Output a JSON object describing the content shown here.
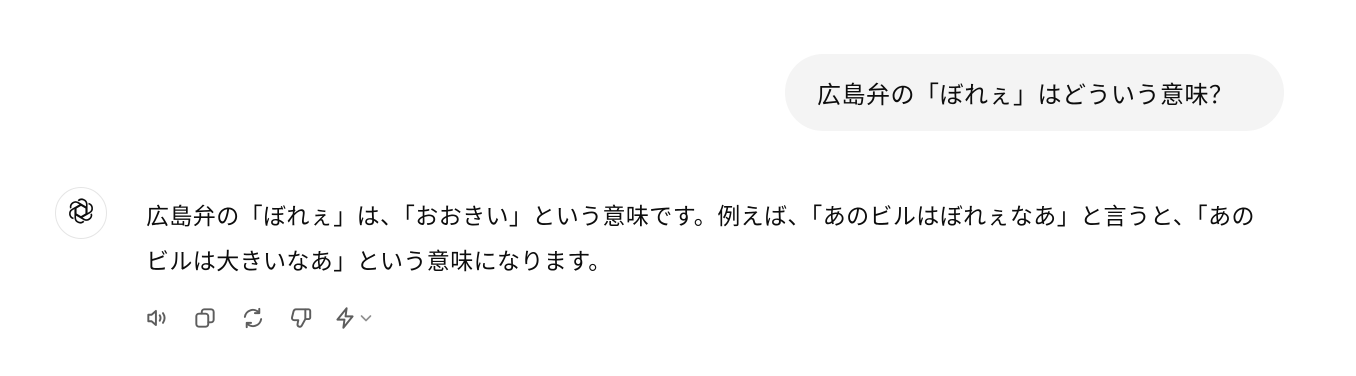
{
  "conversation": {
    "user_message": "広島弁の「ぼれぇ」はどういう意味？",
    "assistant_message": "広島弁の「ぼれぇ」は、「おおきい」という意味です。例えば、「あのビルはぼれぇなあ」と言うと、「あのビルは大きいなあ」という意味になります。"
  },
  "assistant": {
    "avatar_icon": "openai-logo-icon"
  },
  "actions": [
    {
      "name": "read-aloud-button",
      "icon": "speaker-icon"
    },
    {
      "name": "copy-button",
      "icon": "copy-icon"
    },
    {
      "name": "regenerate-button",
      "icon": "refresh-icon"
    },
    {
      "name": "thumbs-down-button",
      "icon": "thumbs-down-icon"
    },
    {
      "name": "model-switch-button",
      "icon": "bolt-icon"
    }
  ],
  "colors": {
    "user_bubble_bg": "#f4f4f4",
    "text": "#0d0d0d",
    "icon": "#5d5d5d"
  }
}
